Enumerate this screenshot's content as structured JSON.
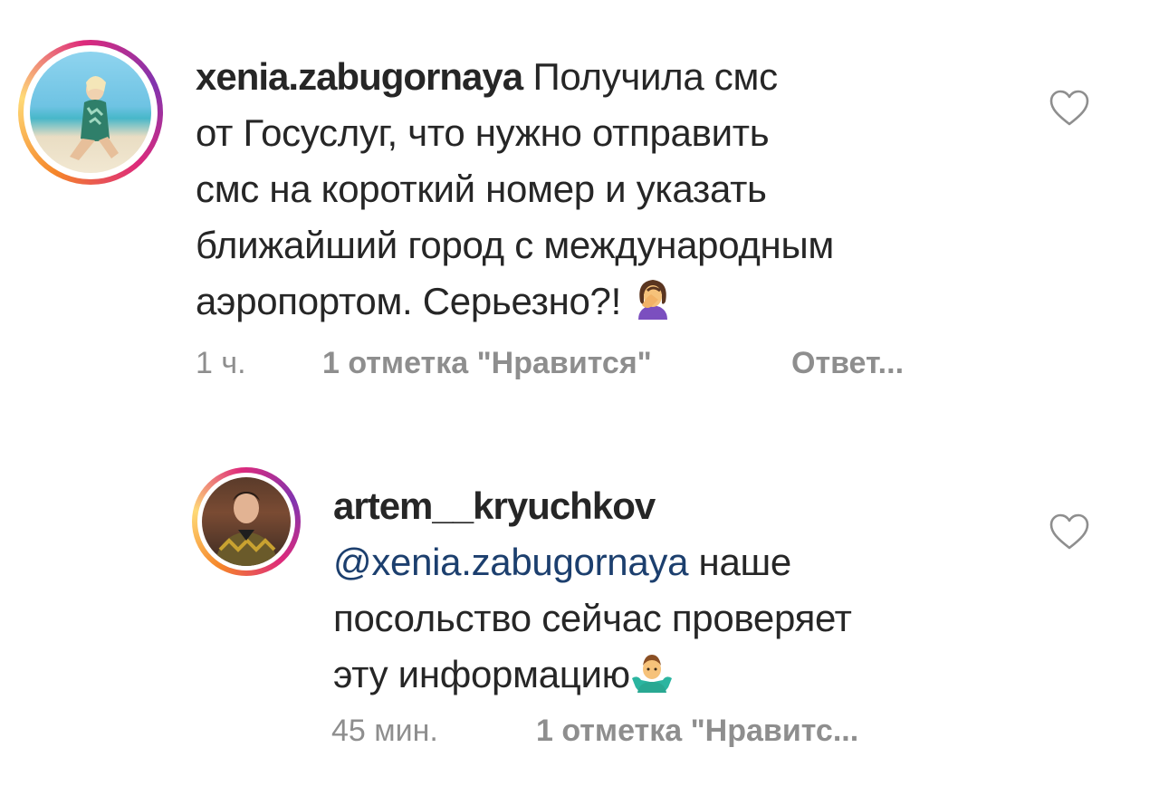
{
  "comments": [
    {
      "username": "xenia.zabugornaya",
      "lines": [
        "Получила смс",
        "от Госуслуг, что нужно отправить",
        "смс на короткий номер и указать",
        "ближайший город с международным",
        "аэропортом. Серьезно?!"
      ],
      "emoji_icon": "woman-facepalming-icon",
      "time": "1 ч.",
      "likes": "1 отметка \"Нравится\"",
      "reply": "Ответ..."
    },
    {
      "username": "artem__kryuchkov",
      "mention": "@xenia.zabugornaya",
      "lines": [
        "наше",
        "посольство сейчас проверяет",
        "эту информацию"
      ],
      "emoji_icon": "man-shrugging-icon",
      "time": "45 мин.",
      "likes": "1 отметка \"Нравитс..."
    }
  ],
  "colors": {
    "text": "#262626",
    "meta": "#8e8e8e",
    "mention": "#1c3f6e",
    "heart_outline": "#8e8e8e"
  }
}
